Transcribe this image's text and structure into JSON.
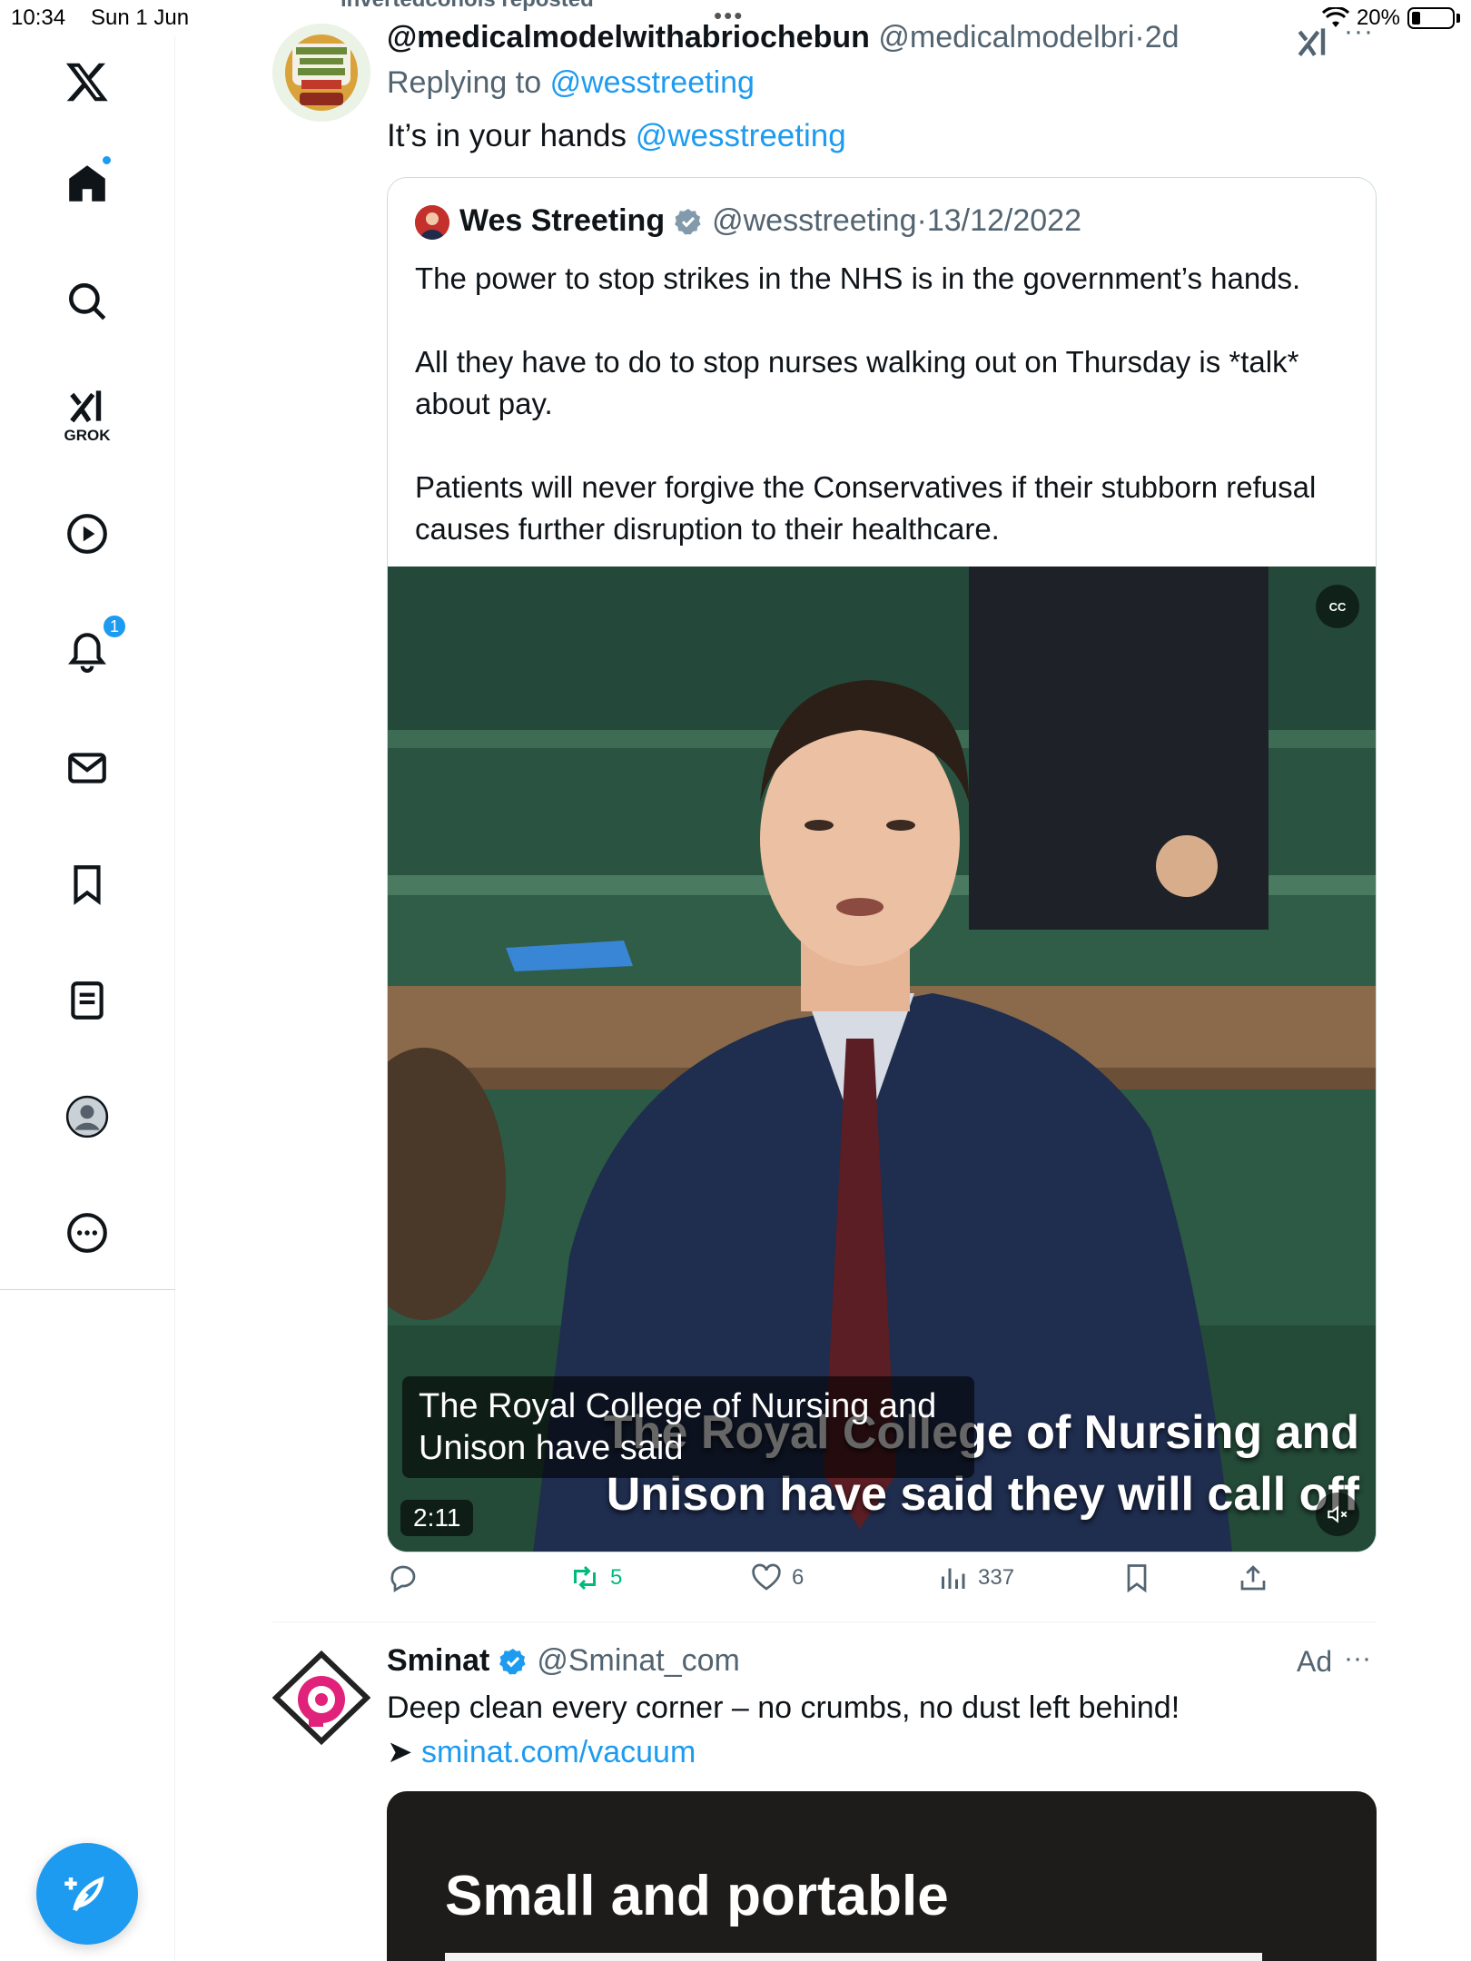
{
  "status_bar": {
    "time": "10:34",
    "date": "Sun 1 Jun",
    "battery": "20%",
    "battery_level": 0.2
  },
  "sidebar": {
    "grok_label": "GROK",
    "notifications_count": "1"
  },
  "tweet": {
    "repost_text": "invertedcohols reposted",
    "author_handle_display": "@medicalmodelwithabriochebun",
    "author_username": "@medicalmodelbri",
    "time_sep": "·",
    "time": "2d",
    "replying_prefix": "Replying to",
    "replying_to": "@wesstreeting",
    "text_prefix": "It’s in your hands",
    "text_mention": "@wesstreeting",
    "more": "···"
  },
  "quote": {
    "name": "Wes Streeting",
    "handle": "@wesstreeting",
    "time_sep": "·",
    "date": "13/12/2022",
    "paragraph1": "The power to stop strikes in the NHS is in the government’s hands.",
    "paragraph2": "All they have to do to stop nurses walking out on Thursday is *talk* about pay.",
    "paragraph3": "Patients will never forgive the Conservatives if their stubborn refusal causes further disruption to their healthcare.",
    "video": {
      "cc_label": "CC",
      "caption": "The Royal College of Nursing and Unison have said",
      "burnt_caption_line1": "The Royal College of Nursing and",
      "burnt_caption_line2": "Unison have said they will call off",
      "duration": "2:11"
    }
  },
  "actions": {
    "retweets": "5",
    "likes": "6",
    "views": "337"
  },
  "ad": {
    "name": "Sminat",
    "handle": "@Sminat_com",
    "label": "Ad",
    "more": "···",
    "text": "Deep clean every corner – no crumbs, no dust left behind!",
    "arrow": "➤",
    "link": "sminat.com/vacuum",
    "media_text": "Small and portable"
  },
  "colors": {
    "accent": "#1d9bf0",
    "retweet_green": "#00ba7c",
    "muted": "#536471"
  }
}
